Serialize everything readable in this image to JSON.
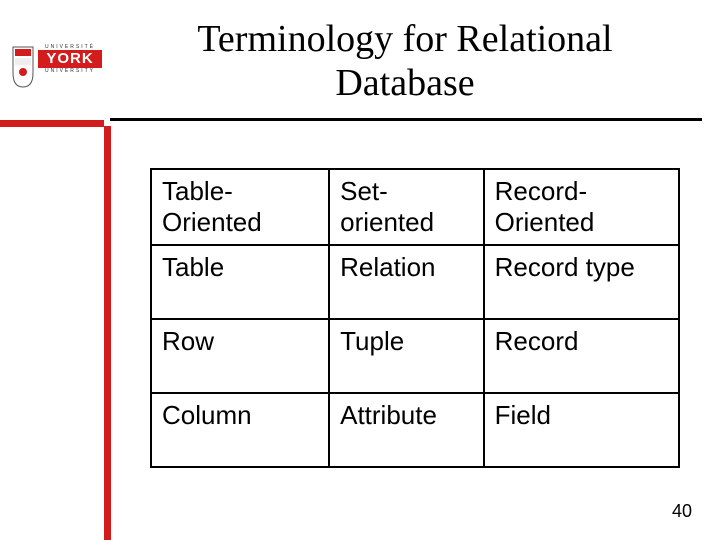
{
  "logo": {
    "top_label": "UNIVERSITÉ",
    "main": "YORK",
    "bottom_label": "UNIVERSITY"
  },
  "title": "Terminology for Relational Database",
  "table": {
    "headers": [
      "Table-Oriented",
      "Set-oriented",
      "Record-Oriented"
    ],
    "rows": [
      [
        "Table",
        "Relation",
        "Record type"
      ],
      [
        "Row",
        "Tuple",
        "Record"
      ],
      [
        "Column",
        "Attribute",
        "Field"
      ]
    ]
  },
  "page_number": "40"
}
